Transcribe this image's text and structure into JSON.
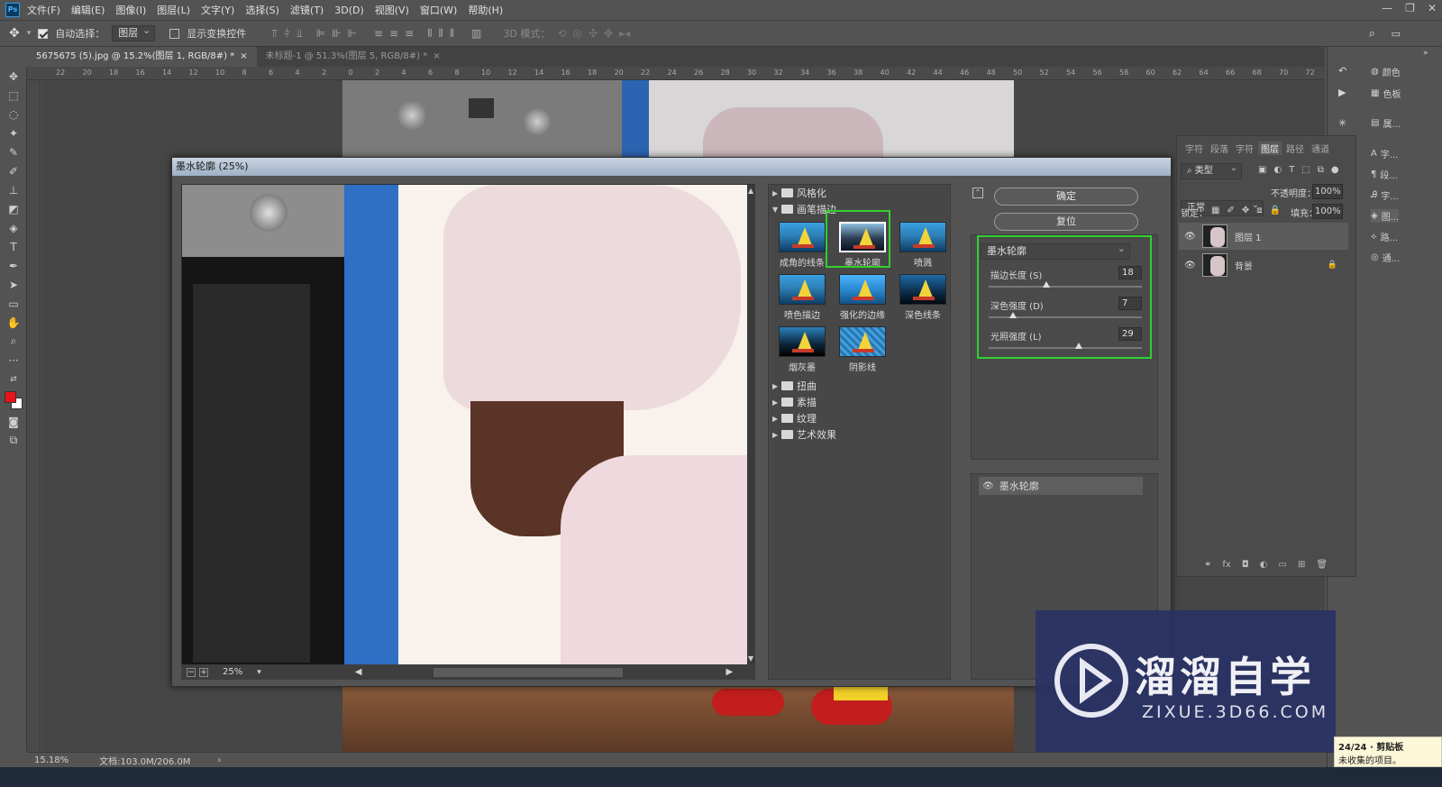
{
  "app": {
    "logo": "Ps",
    "menu": [
      "文件(F)",
      "编辑(E)",
      "图像(I)",
      "图层(L)",
      "文字(Y)",
      "选择(S)",
      "滤镜(T)",
      "3D(D)",
      "视图(V)",
      "窗口(W)",
      "帮助(H)"
    ]
  },
  "options_bar": {
    "auto_select_label": "自动选择：",
    "auto_select_value": "图层",
    "show_transform_label": "显示变换控件",
    "mode_3d_label": "3D 模式："
  },
  "tabs": [
    {
      "label": "5675675 (5).jpg @ 15.2%(图层 1, RGB/8#) *",
      "close": "×"
    },
    {
      "label": "未标题-1 @ 51.3%(图层 5, RGB/8#) *",
      "close": "×"
    }
  ],
  "ruler_top": [
    "22",
    "20",
    "18",
    "16",
    "14",
    "12",
    "10",
    "8",
    "6",
    "4",
    "2",
    "0",
    "2",
    "4",
    "6",
    "8",
    "10",
    "12",
    "14",
    "16",
    "18",
    "20",
    "22",
    "24",
    "26",
    "28",
    "30",
    "32",
    "34",
    "36",
    "38",
    "40",
    "42",
    "44",
    "46",
    "48",
    "50",
    "52",
    "54",
    "56",
    "58",
    "60",
    "62",
    "64",
    "66",
    "68",
    "70",
    "72"
  ],
  "dialog": {
    "title": "墨水轮廓 (25%)",
    "zoom": "25%",
    "gallery": {
      "folders_top": [
        {
          "label": "风格化",
          "open": false
        },
        {
          "label": "画笔描边",
          "open": true
        }
      ],
      "thumbs": [
        {
          "label": "成角的线条",
          "selected": false
        },
        {
          "label": "墨水轮廓",
          "selected": true
        },
        {
          "label": "喷溅",
          "selected": false
        },
        {
          "label": "喷色描边",
          "selected": false
        },
        {
          "label": "强化的边缘",
          "selected": false
        },
        {
          "label": "深色线条",
          "selected": false
        },
        {
          "label": "烟灰墨",
          "selected": false
        },
        {
          "label": "阴影线",
          "selected": false
        }
      ],
      "folders_bottom": [
        {
          "label": "扭曲"
        },
        {
          "label": "素描"
        },
        {
          "label": "纹理"
        },
        {
          "label": "艺术效果"
        }
      ]
    },
    "ok_label": "确定",
    "reset_label": "复位",
    "filter_select": "墨水轮廓",
    "params": [
      {
        "label": "描边长度 (S)",
        "value": "18",
        "fraction": 0.36
      },
      {
        "label": "深色强度 (D)",
        "value": "7",
        "fraction": 0.14
      },
      {
        "label": "光照强度 (L)",
        "value": "29",
        "fraction": 0.58
      }
    ],
    "effect_layer": "墨水轮廓"
  },
  "layers_panel": {
    "tabs": [
      "字符",
      "段落",
      "字符",
      "图层",
      "路径",
      "通道"
    ],
    "active_tab": "图层",
    "kind_label": "类型",
    "blend_mode": "正常",
    "opacity_label": "不透明度：",
    "opacity_value": "100%",
    "lock_label": "锁定：",
    "fill_label": "填充：",
    "fill_value": "100%",
    "layers": [
      {
        "name": "图层 1",
        "selected": true
      },
      {
        "name": "背景",
        "selected": false
      }
    ]
  },
  "dock": {
    "items": [
      "颜色",
      "色板",
      "属...",
      "字...",
      "段...",
      "字...",
      "图...",
      "路...",
      "通..."
    ]
  },
  "status": {
    "zoom": "15.18%",
    "doc": "文档:103.0M/206.0M"
  },
  "watermark": {
    "brand": "溜溜自学",
    "url": "ZIXUE.3D66.COM"
  },
  "notification": {
    "line1": "24/24 · 剪贴板",
    "line2": "未收集的项目。"
  },
  "colors": {
    "foreground": "#e8141a",
    "background": "#ffffff",
    "highlight": "#2fd12f"
  }
}
